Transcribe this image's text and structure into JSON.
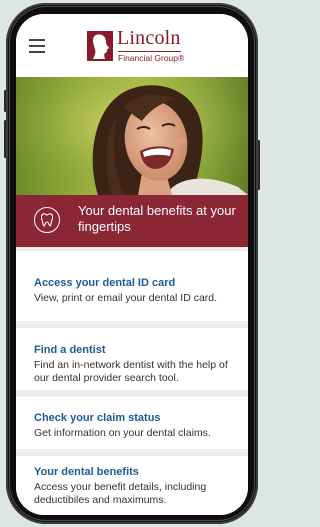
{
  "header": {
    "logo": {
      "name": "Lincoln",
      "subtitle": "Financial Group®",
      "brand_color": "#8a1b2b"
    },
    "menu_icon": "hamburger-menu-icon"
  },
  "hero": {
    "image": "photo of a smiling woman outdoors"
  },
  "banner": {
    "icon": "tooth-icon",
    "text": "Your dental benefits at your fingertips",
    "color": "#8b2635"
  },
  "cards": [
    {
      "title": "Access your dental ID card",
      "description": "View, print or email your dental ID card."
    },
    {
      "title": "Find a dentist",
      "description": "Find an in-network dentist with the help of our dental provider search tool."
    },
    {
      "title": "Check your claim status",
      "description": "Get information on your dental claims."
    },
    {
      "title": "Your dental benefits",
      "description": "Access your benefit details, including deductibiles and maximums."
    }
  ],
  "colors": {
    "link": "#1f5a93",
    "text": "#333333",
    "separator": "#ececec"
  }
}
